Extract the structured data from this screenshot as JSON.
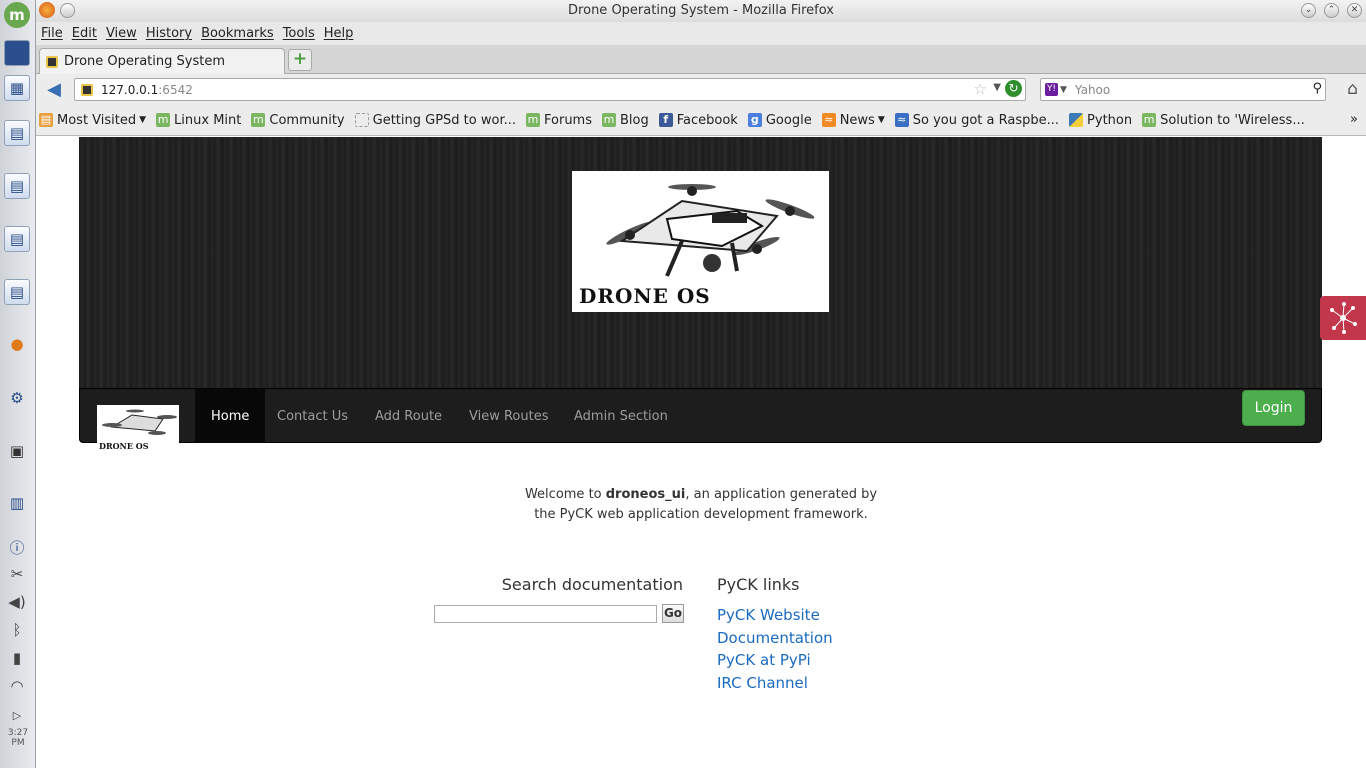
{
  "window": {
    "title": "Drone Operating System - Mozilla Firefox"
  },
  "menu": [
    "File",
    "Edit",
    "View",
    "History",
    "Bookmarks",
    "Tools",
    "Help"
  ],
  "tab": {
    "label": "Drone Operating System"
  },
  "url": {
    "host": "127.0.0.1",
    "port": ":6542"
  },
  "search_engine": {
    "placeholder": "Yahoo"
  },
  "bookmarks": [
    {
      "label": "Most Visited",
      "icon": "folder-icon",
      "dropdown": true
    },
    {
      "label": "Linux Mint",
      "icon": "mint-icon"
    },
    {
      "label": "Community",
      "icon": "mint-icon"
    },
    {
      "label": "Getting GPSd to wor...",
      "icon": "blank-icon"
    },
    {
      "label": "Forums",
      "icon": "mint-icon"
    },
    {
      "label": "Blog",
      "icon": "mint-icon"
    },
    {
      "label": "Facebook",
      "icon": "facebook-icon"
    },
    {
      "label": "Google",
      "icon": "google-icon"
    },
    {
      "label": "News",
      "icon": "rss-icon",
      "dropdown": true
    },
    {
      "label": "So you got a Raspbe...",
      "icon": "rss-icon"
    },
    {
      "label": "Python",
      "icon": "python-icon"
    },
    {
      "label": "Solution to 'Wireless...",
      "icon": "mint-icon"
    }
  ],
  "site": {
    "hero_logo_text": "DRONE OS",
    "nav": [
      "Home",
      "Contact Us",
      "Add Route",
      "View Routes",
      "Admin Section"
    ],
    "login": "Login",
    "welcome_pre": "Welcome to ",
    "welcome_app": "droneos_ui",
    "welcome_post": ", an application generated by",
    "welcome_line2": "the PyCK web application development framework.",
    "search_title": "Search documentation",
    "go": "Go",
    "links_title": "PyCK links",
    "links": [
      "PyCK Website",
      "Documentation",
      "PyCK at PyPi",
      "IRC Channel"
    ]
  },
  "panel": {
    "clock": "3:27 PM"
  },
  "colors": {
    "login": "#4cae4c",
    "link": "#1a6ac0",
    "hero": "#1e1e1e"
  }
}
